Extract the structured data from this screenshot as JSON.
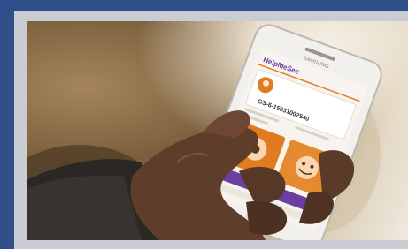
{
  "image": {
    "phone_brand": "SAMSUNG",
    "app_logo": "HelpMeSee",
    "id_text": "GS-6-15031002540",
    "colors": {
      "frame_blue": "#2f4f8a",
      "mat_gray": "#c9ccd3",
      "app_orange": "#e07b1f",
      "app_purple": "#6b3fa0",
      "phone_body": "#f2f0ec"
    }
  }
}
